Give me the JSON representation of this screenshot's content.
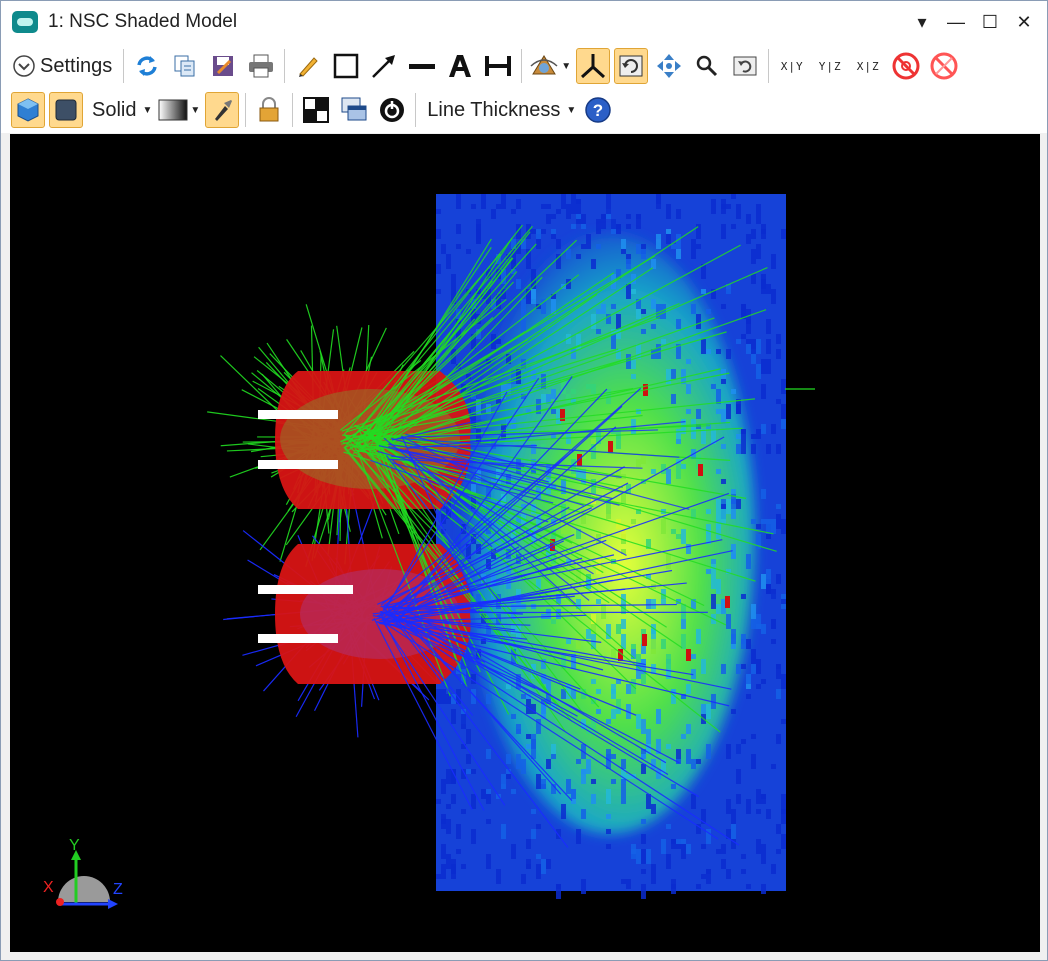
{
  "window": {
    "title": "1: NSC Shaded Model",
    "controls": {
      "dropdown": "▾",
      "minimize": "—",
      "maximize": "☐",
      "close": "✕"
    }
  },
  "toolbar1": {
    "settings_label": "Settings",
    "items": [
      "refresh-icon",
      "copy-icon",
      "save-icon",
      "print-icon",
      "pencil-icon",
      "rectangle-icon",
      "arrow-icon",
      "line-icon",
      "text-icon",
      "dimension-icon",
      "rotate-view-icon",
      "axes-icon",
      "reset-rotation-icon",
      "pan-icon",
      "zoom-icon",
      "undo-zoom-icon",
      "xy-view",
      "yz-view",
      "xz-view",
      "disable-icon",
      "clear-icon"
    ],
    "view_labels": {
      "xy": "X|Y",
      "yz": "Y|Z",
      "xz": "X|Z"
    }
  },
  "toolbar2": {
    "render_mode_label": "Solid",
    "line_thickness_label": "Line Thickness"
  },
  "axes": {
    "y": "Y",
    "x": "X",
    "z": "Z"
  },
  "colors": {
    "canvas_bg": "#000000",
    "ray_green": "#22dd22",
    "ray_blue": "#1a2cff",
    "lens_red": "#dd1010",
    "active_tool": "#ffd98e"
  }
}
